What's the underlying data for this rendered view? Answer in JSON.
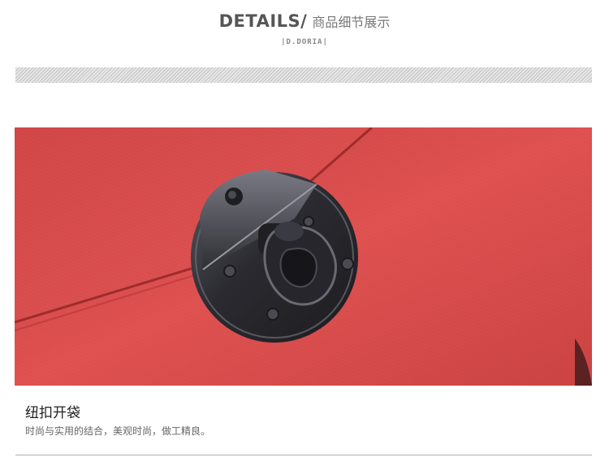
{
  "header": {
    "title_en": "DETAILS/",
    "title_cn": "商品细节展示",
    "brand_tag": "|D.DORIA|"
  },
  "photo": {
    "subject": "red saffiano leather bag with gunmetal twist-lock clasp"
  },
  "caption": {
    "title": "纽扣开袋",
    "text": "时尚与实用的结合，美观时尚，做工精良。"
  },
  "colors": {
    "leather": "#d84848",
    "hardware": "#2e2e33",
    "stripe": "#c4c4c4"
  }
}
